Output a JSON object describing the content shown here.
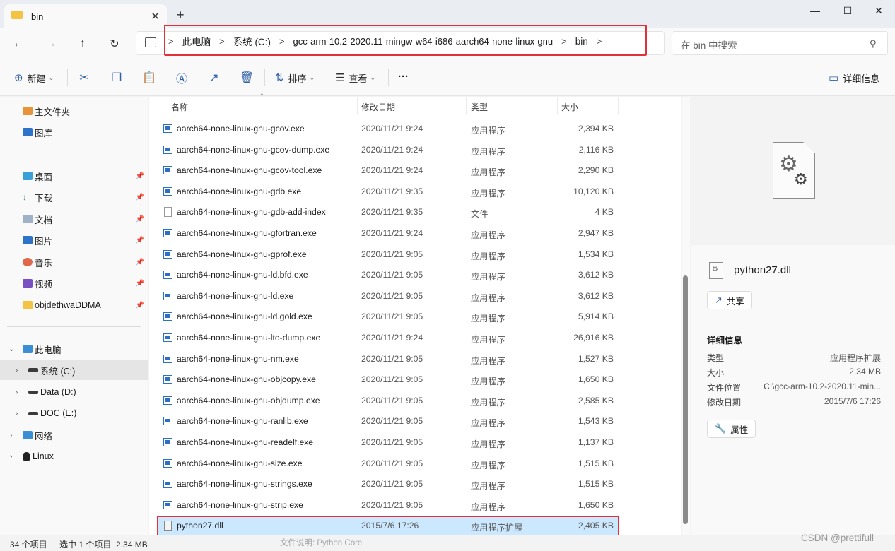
{
  "tab": {
    "title": "bin"
  },
  "window": {
    "new_tab": "+",
    "minimize": "—",
    "maximize": "☐",
    "close": "✕"
  },
  "nav_buttons": {
    "back": "←",
    "forward": "→",
    "up": "↑",
    "refresh": "↻"
  },
  "breadcrumb": [
    "此电脑",
    "系统 (C:)",
    "gcc-arm-10.2-2020.11-mingw-w64-i686-aarch64-none-linux-gnu",
    "bin"
  ],
  "breadcrumb_sep": ">",
  "search": {
    "placeholder": "在 bin 中搜索"
  },
  "toolbar": {
    "new_label": "新建",
    "sort_label": "排序",
    "view_label": "查看",
    "more_label": "···",
    "details_label": "详细信息"
  },
  "sidebar": {
    "items": [
      {
        "label": "主文件夹"
      },
      {
        "label": "图库"
      },
      {
        "label": "桌面"
      },
      {
        "label": "下载"
      },
      {
        "label": "文档"
      },
      {
        "label": "图片"
      },
      {
        "label": "音乐"
      },
      {
        "label": "视频"
      },
      {
        "label": "objdethwaDDMA"
      },
      {
        "label": "此电脑"
      },
      {
        "label": "系统 (C:)"
      },
      {
        "label": "Data (D:)"
      },
      {
        "label": "DOC (E:)"
      },
      {
        "label": "网络"
      },
      {
        "label": "Linux"
      }
    ]
  },
  "columns": {
    "name": "名称",
    "date": "修改日期",
    "type": "类型",
    "size": "大小"
  },
  "files": [
    {
      "name": "aarch64-none-linux-gnu-gcov.exe",
      "date": "2020/11/21 9:24",
      "type": "应用程序",
      "size": "2,394 KB",
      "icon": "exe"
    },
    {
      "name": "aarch64-none-linux-gnu-gcov-dump.exe",
      "date": "2020/11/21 9:24",
      "type": "应用程序",
      "size": "2,116 KB",
      "icon": "exe"
    },
    {
      "name": "aarch64-none-linux-gnu-gcov-tool.exe",
      "date": "2020/11/21 9:24",
      "type": "应用程序",
      "size": "2,290 KB",
      "icon": "exe"
    },
    {
      "name": "aarch64-none-linux-gnu-gdb.exe",
      "date": "2020/11/21 9:35",
      "type": "应用程序",
      "size": "10,120 KB",
      "icon": "exe"
    },
    {
      "name": "aarch64-none-linux-gnu-gdb-add-index",
      "date": "2020/11/21 9:35",
      "type": "文件",
      "size": "4 KB",
      "icon": "doc"
    },
    {
      "name": "aarch64-none-linux-gnu-gfortran.exe",
      "date": "2020/11/21 9:24",
      "type": "应用程序",
      "size": "2,947 KB",
      "icon": "exe"
    },
    {
      "name": "aarch64-none-linux-gnu-gprof.exe",
      "date": "2020/11/21 9:05",
      "type": "应用程序",
      "size": "1,534 KB",
      "icon": "exe"
    },
    {
      "name": "aarch64-none-linux-gnu-ld.bfd.exe",
      "date": "2020/11/21 9:05",
      "type": "应用程序",
      "size": "3,612 KB",
      "icon": "exe"
    },
    {
      "name": "aarch64-none-linux-gnu-ld.exe",
      "date": "2020/11/21 9:05",
      "type": "应用程序",
      "size": "3,612 KB",
      "icon": "exe"
    },
    {
      "name": "aarch64-none-linux-gnu-ld.gold.exe",
      "date": "2020/11/21 9:05",
      "type": "应用程序",
      "size": "5,914 KB",
      "icon": "exe"
    },
    {
      "name": "aarch64-none-linux-gnu-lto-dump.exe",
      "date": "2020/11/21 9:24",
      "type": "应用程序",
      "size": "26,916 KB",
      "icon": "exe"
    },
    {
      "name": "aarch64-none-linux-gnu-nm.exe",
      "date": "2020/11/21 9:05",
      "type": "应用程序",
      "size": "1,527 KB",
      "icon": "exe"
    },
    {
      "name": "aarch64-none-linux-gnu-objcopy.exe",
      "date": "2020/11/21 9:05",
      "type": "应用程序",
      "size": "1,650 KB",
      "icon": "exe"
    },
    {
      "name": "aarch64-none-linux-gnu-objdump.exe",
      "date": "2020/11/21 9:05",
      "type": "应用程序",
      "size": "2,585 KB",
      "icon": "exe"
    },
    {
      "name": "aarch64-none-linux-gnu-ranlib.exe",
      "date": "2020/11/21 9:05",
      "type": "应用程序",
      "size": "1,543 KB",
      "icon": "exe"
    },
    {
      "name": "aarch64-none-linux-gnu-readelf.exe",
      "date": "2020/11/21 9:05",
      "type": "应用程序",
      "size": "1,137 KB",
      "icon": "exe"
    },
    {
      "name": "aarch64-none-linux-gnu-size.exe",
      "date": "2020/11/21 9:05",
      "type": "应用程序",
      "size": "1,515 KB",
      "icon": "exe"
    },
    {
      "name": "aarch64-none-linux-gnu-strings.exe",
      "date": "2020/11/21 9:05",
      "type": "应用程序",
      "size": "1,515 KB",
      "icon": "exe"
    },
    {
      "name": "aarch64-none-linux-gnu-strip.exe",
      "date": "2020/11/21 9:05",
      "type": "应用程序",
      "size": "1,650 KB",
      "icon": "exe"
    },
    {
      "name": "python27.dll",
      "date": "2015/7/6 17:26",
      "type": "应用程序扩展",
      "size": "2,405 KB",
      "icon": "dll",
      "selected": true
    }
  ],
  "details": {
    "filename": "python27.dll",
    "share_label": "共享",
    "section_title": "详细信息",
    "props": [
      {
        "key": "类型",
        "value": "应用程序扩展"
      },
      {
        "key": "大小",
        "value": "2.34 MB"
      },
      {
        "key": "文件位置",
        "value": "C:\\gcc-arm-10.2-2020.11-min..."
      },
      {
        "key": "修改日期",
        "value": "2015/7/6 17:26"
      }
    ],
    "properties_label": "属性"
  },
  "status": {
    "item_count": "34 个项目",
    "selection": "选中 1 个项目  2.34 MB",
    "hover_hint": "文件说明: Python Core",
    "watermark": "CSDN @prettifull"
  },
  "colors": {
    "accent": "#2f5fa8",
    "selection": "#cce8ff",
    "highlight_box": "#e0303a",
    "folder": "#f5c343"
  }
}
